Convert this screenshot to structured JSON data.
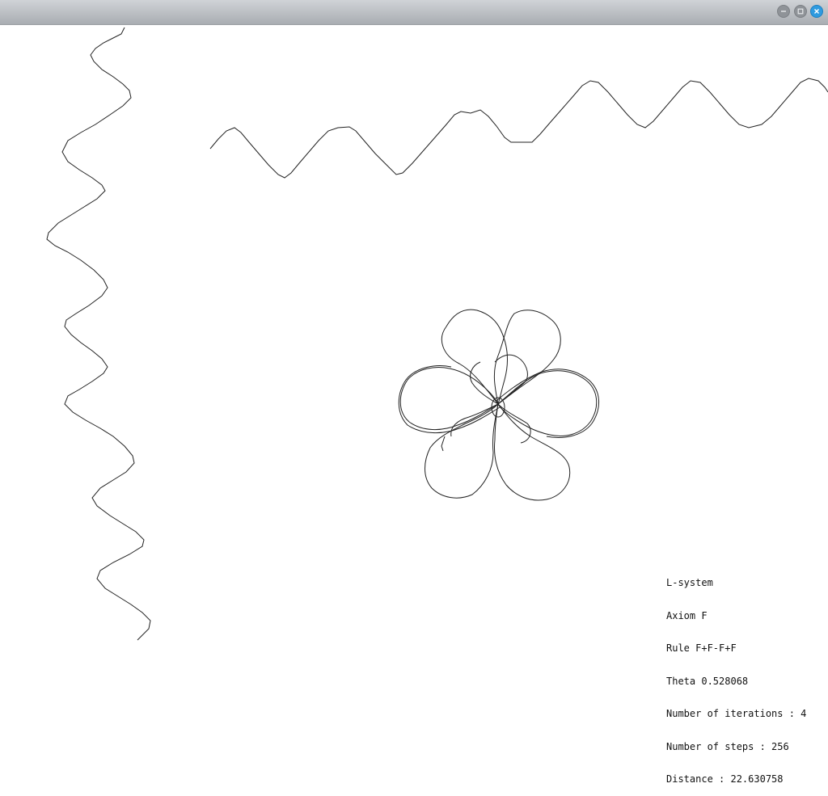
{
  "window": {
    "buttons": [
      {
        "name": "minimize",
        "icon": "minimize-icon"
      },
      {
        "name": "maximize",
        "icon": "maximize-icon"
      },
      {
        "name": "close",
        "icon": "close-icon"
      }
    ]
  },
  "colors": {
    "line": "#222222",
    "close_button": "#2f9be0"
  },
  "info": {
    "title": "L-system",
    "axiom": "Axiom F",
    "rule": "Rule F+F-F+F",
    "theta": "Theta 0.528068",
    "iterations": "Number of iterations : 4",
    "steps": "Number of steps : 256",
    "distance": "Distance : 22.630758"
  }
}
